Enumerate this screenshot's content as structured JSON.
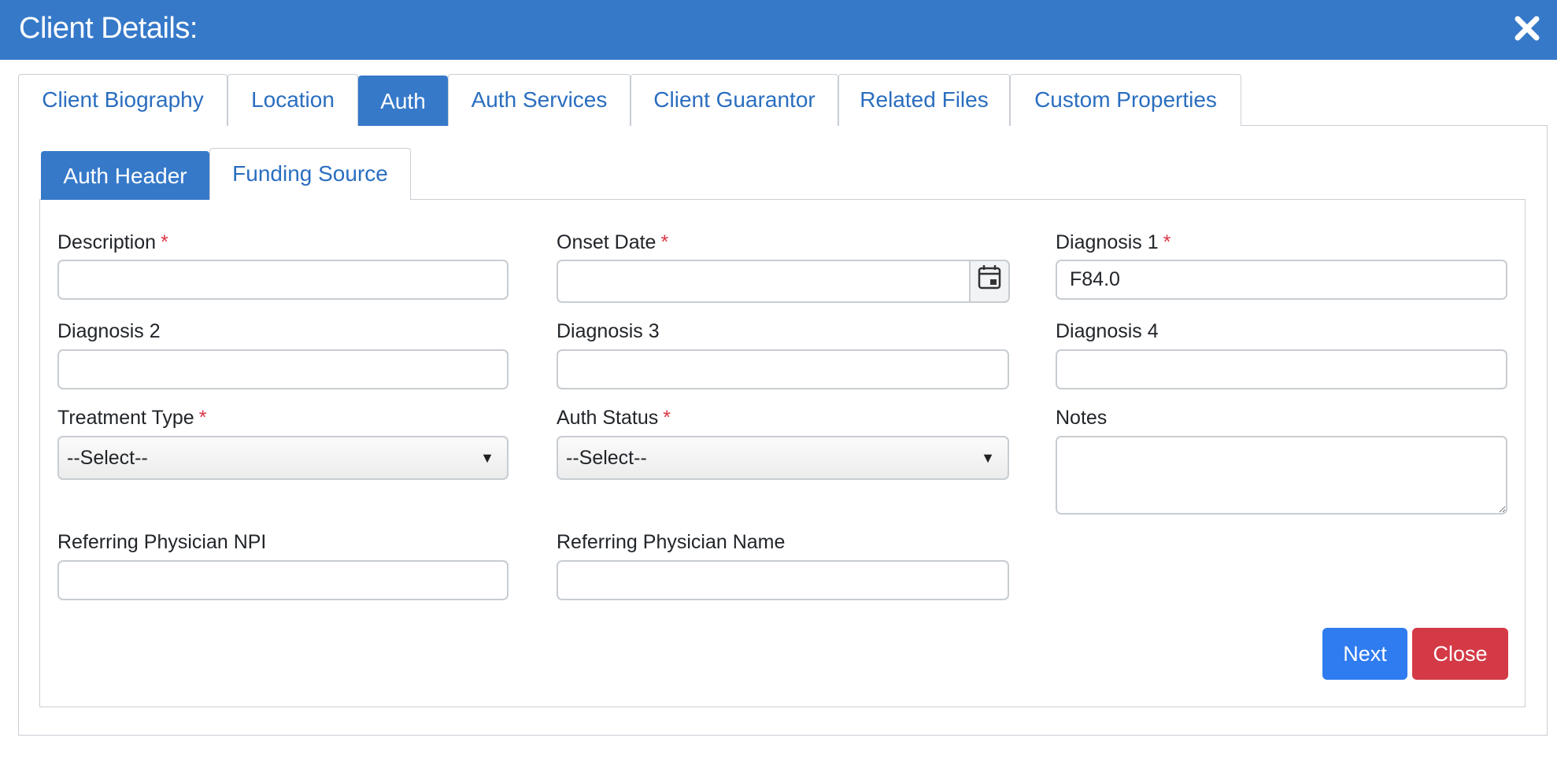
{
  "modal": {
    "title": "Client Details:"
  },
  "tabs": [
    {
      "label": "Client Biography"
    },
    {
      "label": "Location"
    },
    {
      "label": "Auth"
    },
    {
      "label": "Auth Services"
    },
    {
      "label": "Client Guarantor"
    },
    {
      "label": "Related Files"
    },
    {
      "label": "Custom Properties"
    }
  ],
  "subtabs": [
    {
      "label": "Auth Header"
    },
    {
      "label": "Funding Source"
    }
  ],
  "form": {
    "description": {
      "label": "Description",
      "value": ""
    },
    "onset_date": {
      "label": "Onset Date",
      "value": ""
    },
    "diagnosis1": {
      "label": "Diagnosis 1",
      "value": "F84.0"
    },
    "diagnosis2": {
      "label": "Diagnosis 2",
      "value": ""
    },
    "diagnosis3": {
      "label": "Diagnosis 3",
      "value": ""
    },
    "diagnosis4": {
      "label": "Diagnosis 4",
      "value": ""
    },
    "treatment_type": {
      "label": "Treatment Type",
      "selected": "--Select--"
    },
    "auth_status": {
      "label": "Auth Status",
      "selected": "--Select--"
    },
    "notes": {
      "label": "Notes",
      "value": ""
    },
    "ref_npi": {
      "label": "Referring Physician NPI",
      "value": ""
    },
    "ref_name": {
      "label": "Referring Physician Name",
      "value": ""
    },
    "required_marker": "*"
  },
  "buttons": {
    "next": "Next",
    "close": "Close"
  },
  "colors": {
    "accent": "#3679c9",
    "primary_button": "#2f7bf0",
    "danger_button": "#d33a45",
    "required": "#dc3545"
  },
  "icons": {
    "close": "close-icon",
    "calendar": "calendar-icon",
    "dropdown": "caret-down-icon"
  }
}
